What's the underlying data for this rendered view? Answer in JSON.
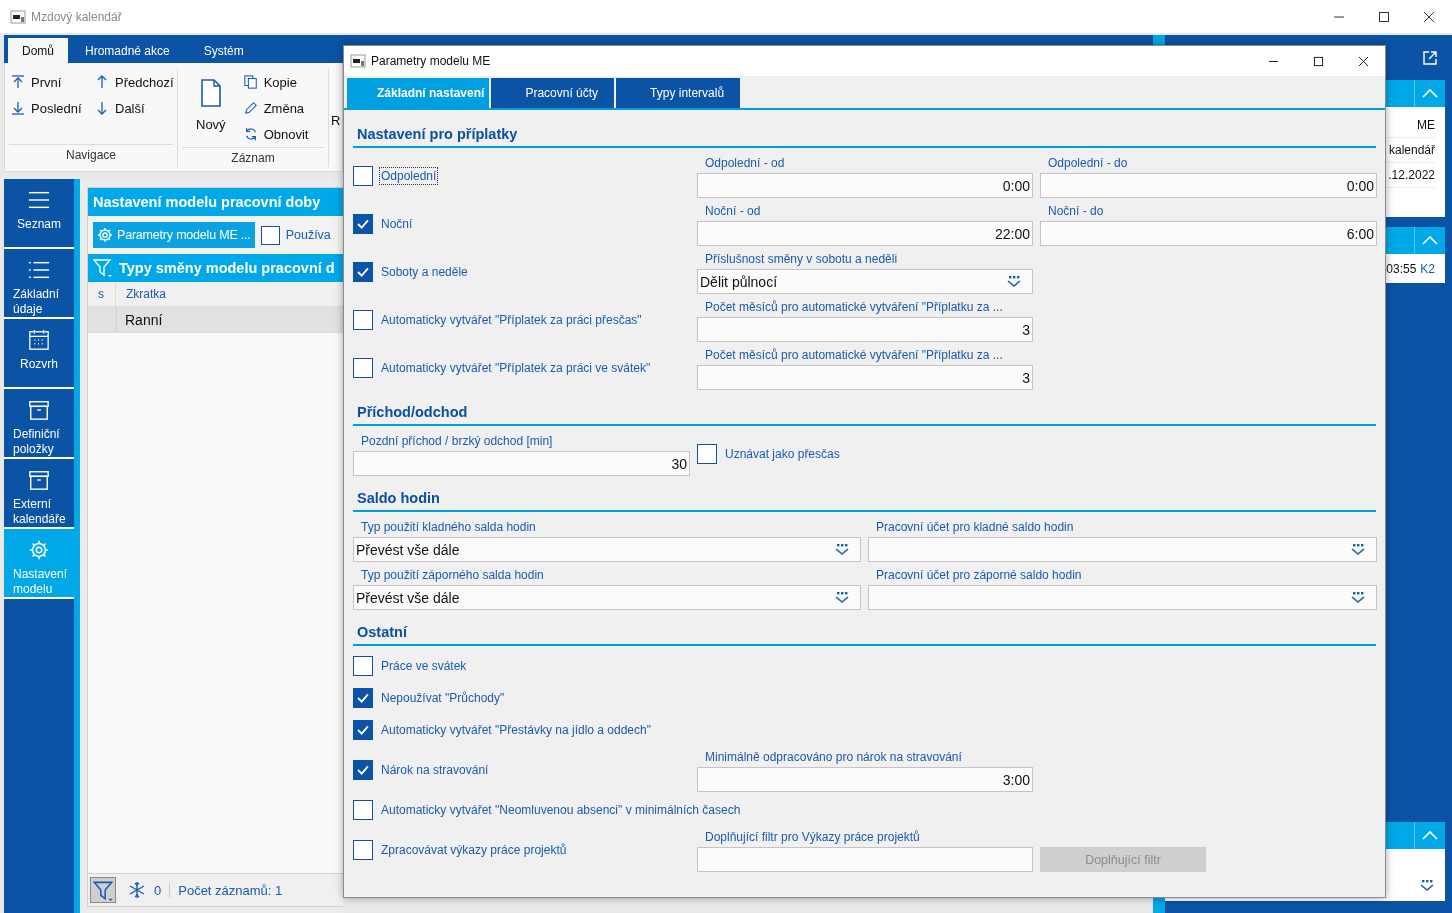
{
  "window": {
    "title": "Mzdový kalendář"
  },
  "ribbon": {
    "tabs": [
      {
        "label": "Domů",
        "selected": true
      },
      {
        "label": "Hromadné akce",
        "selected": false
      },
      {
        "label": "Systém",
        "selected": false
      }
    ],
    "groups": [
      {
        "title": "Navigace",
        "items": [
          "První",
          "Předchozí",
          "Poslední",
          "Další"
        ]
      },
      {
        "title": "Záznam",
        "items": [
          "Nový",
          "Kopie",
          "Změna",
          "Obnovit"
        ]
      },
      {
        "items": [
          "R"
        ]
      }
    ]
  },
  "nav": [
    {
      "label": "Seznam",
      "selected": false
    },
    {
      "label": "Základní údaje",
      "selected": false
    },
    {
      "label": "Rozvrh",
      "selected": false
    },
    {
      "label": "Definiční položky",
      "selected": false
    },
    {
      "label": "Externí kalendáře",
      "selected": false
    },
    {
      "label": "Nastavení modelu",
      "selected": true
    }
  ],
  "panel": {
    "title": "Nastavení modelu pracovní doby",
    "button": "Parametry modelu ME ...",
    "checkbox": {
      "label": "Používa",
      "checked": false
    },
    "grid": {
      "title": "Typy směny modelu pracovní d",
      "columns": [
        "s",
        "Zkratka"
      ],
      "rows": [
        {
          "zkratka": "Ranní",
          "selected": true
        }
      ]
    },
    "status": {
      "count": "0",
      "records": "Počet záznamů: 1"
    }
  },
  "right_panel": {
    "info": [
      "ME",
      "kalendář",
      ".12.2022"
    ],
    "time": "03:55",
    "source": "K2"
  },
  "dialog": {
    "title": "Parametry modelu ME",
    "tabs": [
      {
        "label": "Základní nastavení",
        "selected": true
      },
      {
        "label": "Pracovní účty",
        "selected": false
      },
      {
        "label": "Typy intervalů",
        "selected": false
      }
    ],
    "sections": [
      {
        "title": "Nastavení pro příplatky",
        "kind": "grid3",
        "rows": [
          {
            "cells": [
              {
                "kind": "checkbox",
                "label": "Odpolední",
                "checked": false,
                "focused": true
              },
              {
                "kind": "input",
                "label": "Odpolední - od",
                "value": "0:00"
              },
              {
                "kind": "input",
                "label": "Odpolední - do",
                "value": "0:00"
              }
            ]
          },
          {
            "cells": [
              {
                "kind": "checkbox",
                "label": "Noční",
                "checked": true,
                "focused": false
              },
              {
                "kind": "input",
                "label": "Noční - od",
                "value": "22:00"
              },
              {
                "kind": "input",
                "label": "Noční - do",
                "value": "6:00"
              }
            ]
          },
          {
            "cells": [
              {
                "kind": "checkbox",
                "label": "Soboty a neděle",
                "checked": true,
                "focused": false
              },
              {
                "kind": "select",
                "label": "Příslušnost směny v sobotu a neděli",
                "value": "Dělit půlnocí"
              }
            ]
          },
          {
            "cells": [
              {
                "kind": "checkbox",
                "label": "Automaticky vytvářet \"Příplatek za práci přesčas\"",
                "checked": false,
                "focused": false
              },
              {
                "kind": "input",
                "label": "Počet měsíců pro automatické vytváření \"Příplatku za ...",
                "value": "3"
              }
            ]
          },
          {
            "cells": [
              {
                "kind": "checkbox",
                "label": "Automaticky vytvářet \"Příplatek za práci ve svátek\"",
                "checked": false,
                "focused": false
              },
              {
                "kind": "input",
                "label": "Počet měsíců pro automatické vytváření \"Příplatku za ...",
                "value": "3"
              }
            ]
          }
        ]
      },
      {
        "title": "Příchod/odchod",
        "kind": "grid3",
        "rows": [
          {
            "cells": [
              {
                "kind": "input",
                "label": "Pozdní příchod / brzký odchod [min]",
                "value": "30"
              },
              {
                "kind": "checkbox",
                "label": "Uznávat jako přesčas",
                "checked": false,
                "focused": false
              }
            ]
          }
        ]
      },
      {
        "title": "Saldo hodin",
        "kind": "halves",
        "rows": [
          {
            "cells": [
              {
                "kind": "select",
                "label": "Typ použití kladného salda hodin",
                "value": "Převést vše dále"
              },
              {
                "kind": "select",
                "label": "Pracovní účet pro kladné saldo hodin"
              }
            ]
          },
          {
            "cells": [
              {
                "kind": "select",
                "label": "Typ použití záporného salda hodin",
                "value": "Převést vše dále"
              },
              {
                "kind": "select",
                "label": "Pracovní účet pro záporné saldo hodin"
              }
            ]
          }
        ]
      },
      {
        "title": "Ostatní",
        "kind": "grid3",
        "rows": [
          {
            "cells": [
              {
                "kind": "checkbox",
                "label": "Práce ve svátek",
                "checked": false,
                "focused": false
              }
            ]
          },
          {
            "cells": [
              {
                "kind": "checkbox",
                "label": "Nepoužívat \"Průchody\"",
                "checked": true,
                "focused": false
              }
            ]
          },
          {
            "cells": [
              {
                "kind": "checkbox",
                "label": "Automaticky vytvářet \"Přestávky na jídlo a oddech\"",
                "checked": true,
                "focused": false
              }
            ]
          },
          {
            "cells": [
              {
                "kind": "checkbox",
                "label": "Nárok na stravování",
                "checked": true,
                "focused": false
              },
              {
                "kind": "input",
                "label": "Minimálně odpracováno pro nárok na stravování",
                "value": "3:00"
              }
            ]
          },
          {
            "cells": [
              {
                "kind": "checkbox",
                "label": "Automaticky vytvářet \"Neomluvenou absenci\" v minimálních časech",
                "checked": false,
                "focused": false
              }
            ]
          },
          {
            "cells": [
              {
                "kind": "checkbox",
                "label": "Zpracovávat výkazy práce projektů",
                "checked": false,
                "focused": false
              },
              {
                "kind": "input",
                "label": "Doplňující filtr pro Výkazy práce projektů"
              },
              {
                "kind": "button",
                "label": "Doplňující filtr",
                "disabled": true
              }
            ]
          }
        ]
      }
    ]
  }
}
